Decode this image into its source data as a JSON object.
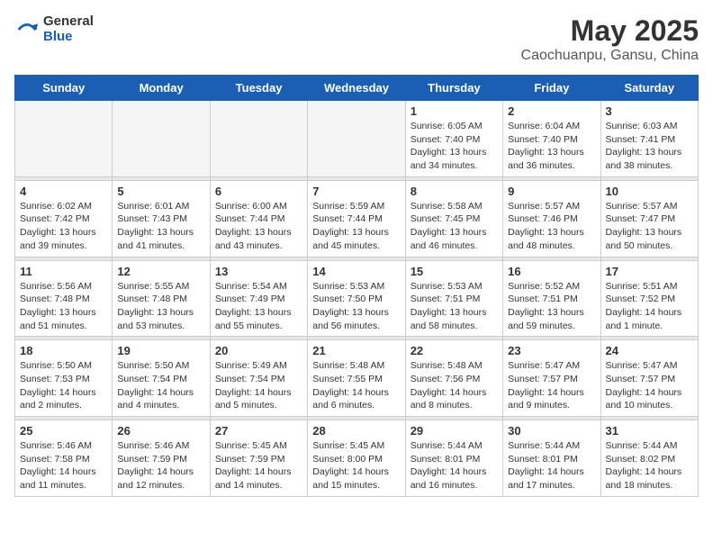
{
  "header": {
    "logo_general": "General",
    "logo_blue": "Blue",
    "title": "May 2025",
    "subtitle": "Caochuanpu, Gansu, China"
  },
  "weekdays": [
    "Sunday",
    "Monday",
    "Tuesday",
    "Wednesday",
    "Thursday",
    "Friday",
    "Saturday"
  ],
  "weeks": [
    [
      {
        "day": "",
        "empty": true
      },
      {
        "day": "",
        "empty": true
      },
      {
        "day": "",
        "empty": true
      },
      {
        "day": "",
        "empty": true
      },
      {
        "day": "1",
        "sunrise": "6:05 AM",
        "sunset": "7:40 PM",
        "daylight": "13 hours and 34 minutes."
      },
      {
        "day": "2",
        "sunrise": "6:04 AM",
        "sunset": "7:40 PM",
        "daylight": "13 hours and 36 minutes."
      },
      {
        "day": "3",
        "sunrise": "6:03 AM",
        "sunset": "7:41 PM",
        "daylight": "13 hours and 38 minutes."
      }
    ],
    [
      {
        "day": "4",
        "sunrise": "6:02 AM",
        "sunset": "7:42 PM",
        "daylight": "13 hours and 39 minutes."
      },
      {
        "day": "5",
        "sunrise": "6:01 AM",
        "sunset": "7:43 PM",
        "daylight": "13 hours and 41 minutes."
      },
      {
        "day": "6",
        "sunrise": "6:00 AM",
        "sunset": "7:44 PM",
        "daylight": "13 hours and 43 minutes."
      },
      {
        "day": "7",
        "sunrise": "5:59 AM",
        "sunset": "7:44 PM",
        "daylight": "13 hours and 45 minutes."
      },
      {
        "day": "8",
        "sunrise": "5:58 AM",
        "sunset": "7:45 PM",
        "daylight": "13 hours and 46 minutes."
      },
      {
        "day": "9",
        "sunrise": "5:57 AM",
        "sunset": "7:46 PM",
        "daylight": "13 hours and 48 minutes."
      },
      {
        "day": "10",
        "sunrise": "5:57 AM",
        "sunset": "7:47 PM",
        "daylight": "13 hours and 50 minutes."
      }
    ],
    [
      {
        "day": "11",
        "sunrise": "5:56 AM",
        "sunset": "7:48 PM",
        "daylight": "13 hours and 51 minutes."
      },
      {
        "day": "12",
        "sunrise": "5:55 AM",
        "sunset": "7:48 PM",
        "daylight": "13 hours and 53 minutes."
      },
      {
        "day": "13",
        "sunrise": "5:54 AM",
        "sunset": "7:49 PM",
        "daylight": "13 hours and 55 minutes."
      },
      {
        "day": "14",
        "sunrise": "5:53 AM",
        "sunset": "7:50 PM",
        "daylight": "13 hours and 56 minutes."
      },
      {
        "day": "15",
        "sunrise": "5:53 AM",
        "sunset": "7:51 PM",
        "daylight": "13 hours and 58 minutes."
      },
      {
        "day": "16",
        "sunrise": "5:52 AM",
        "sunset": "7:51 PM",
        "daylight": "13 hours and 59 minutes."
      },
      {
        "day": "17",
        "sunrise": "5:51 AM",
        "sunset": "7:52 PM",
        "daylight": "14 hours and 1 minute."
      }
    ],
    [
      {
        "day": "18",
        "sunrise": "5:50 AM",
        "sunset": "7:53 PM",
        "daylight": "14 hours and 2 minutes."
      },
      {
        "day": "19",
        "sunrise": "5:50 AM",
        "sunset": "7:54 PM",
        "daylight": "14 hours and 4 minutes."
      },
      {
        "day": "20",
        "sunrise": "5:49 AM",
        "sunset": "7:54 PM",
        "daylight": "14 hours and 5 minutes."
      },
      {
        "day": "21",
        "sunrise": "5:48 AM",
        "sunset": "7:55 PM",
        "daylight": "14 hours and 6 minutes."
      },
      {
        "day": "22",
        "sunrise": "5:48 AM",
        "sunset": "7:56 PM",
        "daylight": "14 hours and 8 minutes."
      },
      {
        "day": "23",
        "sunrise": "5:47 AM",
        "sunset": "7:57 PM",
        "daylight": "14 hours and 9 minutes."
      },
      {
        "day": "24",
        "sunrise": "5:47 AM",
        "sunset": "7:57 PM",
        "daylight": "14 hours and 10 minutes."
      }
    ],
    [
      {
        "day": "25",
        "sunrise": "5:46 AM",
        "sunset": "7:58 PM",
        "daylight": "14 hours and 11 minutes."
      },
      {
        "day": "26",
        "sunrise": "5:46 AM",
        "sunset": "7:59 PM",
        "daylight": "14 hours and 12 minutes."
      },
      {
        "day": "27",
        "sunrise": "5:45 AM",
        "sunset": "7:59 PM",
        "daylight": "14 hours and 14 minutes."
      },
      {
        "day": "28",
        "sunrise": "5:45 AM",
        "sunset": "8:00 PM",
        "daylight": "14 hours and 15 minutes."
      },
      {
        "day": "29",
        "sunrise": "5:44 AM",
        "sunset": "8:01 PM",
        "daylight": "14 hours and 16 minutes."
      },
      {
        "day": "30",
        "sunrise": "5:44 AM",
        "sunset": "8:01 PM",
        "daylight": "14 hours and 17 minutes."
      },
      {
        "day": "31",
        "sunrise": "5:44 AM",
        "sunset": "8:02 PM",
        "daylight": "14 hours and 18 minutes."
      }
    ]
  ]
}
